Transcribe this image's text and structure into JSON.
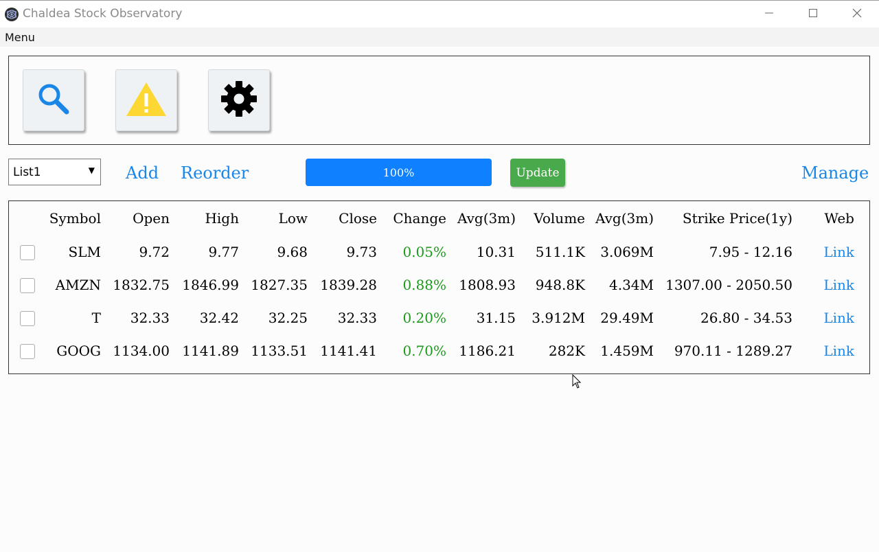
{
  "window": {
    "title": "Chaldea Stock Observatory",
    "controls": [
      "minimize-icon",
      "maximize-icon",
      "close-icon"
    ]
  },
  "menubar": {
    "menu_label": "Menu"
  },
  "toolbar": {
    "buttons": [
      {
        "icon": "search-icon",
        "color": "#1a86e8"
      },
      {
        "icon": "warning-icon",
        "color": "#fdd835"
      },
      {
        "icon": "gear-icon",
        "color": "#000000"
      }
    ]
  },
  "controls": {
    "list_select_value": "List1",
    "add_label": "Add",
    "reorder_label": "Reorder",
    "progress_percent": 100,
    "progress_label": "100%",
    "update_label": "Update",
    "manage_label": "Manage"
  },
  "table": {
    "headers": [
      "",
      "Symbol",
      "Open",
      "High",
      "Low",
      "Close",
      "Change",
      "Avg(3m)",
      "Volume",
      "Avg(3m)",
      "Strike Price(1y)",
      "Web"
    ],
    "rows": [
      {
        "symbol": "SLM",
        "open": "9.72",
        "high": "9.77",
        "low": "9.68",
        "close": "9.73",
        "change": "0.05%",
        "avg3m_price": "10.31",
        "volume": "511.1K",
        "avg3m_volume": "3.069M",
        "strike": "7.95 - 12.16",
        "web": "Link"
      },
      {
        "symbol": "AMZN",
        "open": "1832.75",
        "high": "1846.99",
        "low": "1827.35",
        "close": "1839.28",
        "change": "0.88%",
        "avg3m_price": "1808.93",
        "volume": "948.8K",
        "avg3m_volume": "4.34M",
        "strike": "1307.00 - 2050.50",
        "web": "Link"
      },
      {
        "symbol": "T",
        "open": "32.33",
        "high": "32.42",
        "low": "32.25",
        "close": "32.33",
        "change": "0.20%",
        "avg3m_price": "31.15",
        "volume": "3.912M",
        "avg3m_volume": "29.49M",
        "strike": "26.80 - 34.53",
        "web": "Link"
      },
      {
        "symbol": "GOOG",
        "open": "1134.00",
        "high": "1141.89",
        "low": "1133.51",
        "close": "1141.41",
        "change": "0.70%",
        "avg3m_price": "1186.21",
        "volume": "282K",
        "avg3m_volume": "1.459M",
        "strike": "970.11 - 1289.27",
        "web": "Link"
      }
    ]
  },
  "colors": {
    "accent": "#1a86e8",
    "progress": "#0f80ff",
    "update": "#49aa4c",
    "positive_change": "#1b9a1b"
  }
}
